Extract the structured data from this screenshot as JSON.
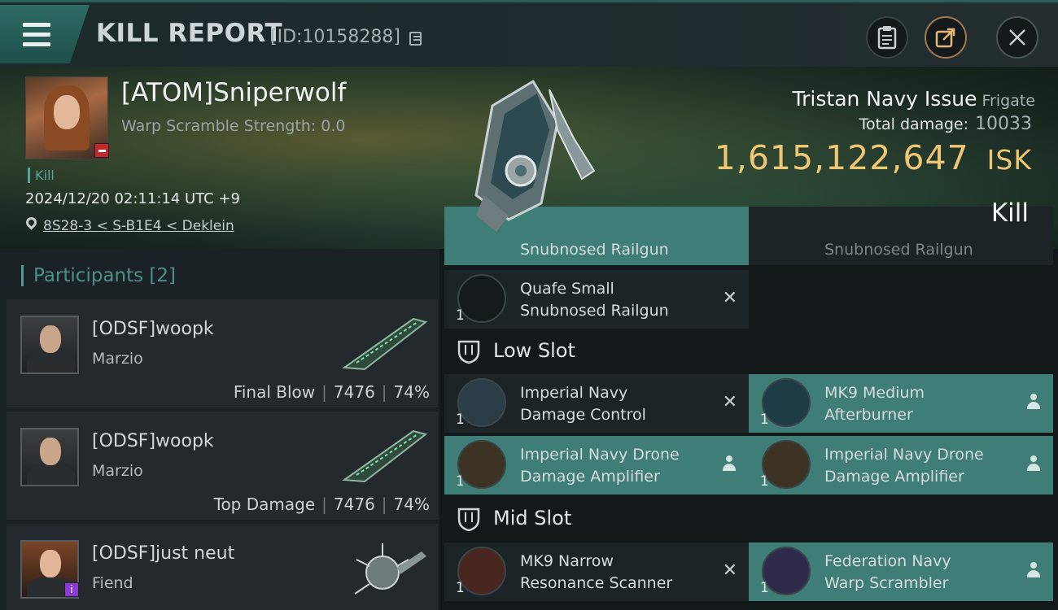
{
  "header": {
    "title": "KILL REPORT",
    "report_id": "[ID:10158288]"
  },
  "victim": {
    "name": "[ATOM]Sniperwolf",
    "warp_scramble": "Warp Scramble Strength: 0.0",
    "tag": "Kill",
    "datetime": "2024/12/20 02:11:14 UTC +9",
    "location": "8S28-3 < S-B1E4 < Deklein",
    "ship_name": "Tristan Navy Issue",
    "ship_class": "Frigate",
    "total_damage_label": "Total damage:",
    "total_damage": "10033",
    "isk_value": "1,615,122,647",
    "isk_unit": "ISK",
    "result_label": "Kill"
  },
  "participants": {
    "label": "Participants [2]",
    "rows": [
      {
        "name": "[ODSF]woopk",
        "ship": "Marzio",
        "stats_label": "Final Blow",
        "damage": "7476",
        "percent": "74%"
      },
      {
        "name": "[ODSF]woopk",
        "ship": "Marzio",
        "stats_label": "Top Damage",
        "damage": "7476",
        "percent": "74%"
      },
      {
        "name": "[ODSF]just neut",
        "ship": "Fiend",
        "stats_label": "",
        "damage": "",
        "percent": ""
      }
    ]
  },
  "modules": {
    "high_partial_left": "Snubnosed Railgun",
    "high_partial_right": "Snubnosed Railgun",
    "high_quafe": {
      "name1": "Quafe Small",
      "name2": "Snubnosed Railgun",
      "qty": "1"
    },
    "low_slot_label": "Low Slot",
    "mid_slot_label": "Mid Slot",
    "low": [
      {
        "name1": "Imperial Navy",
        "name2": "Damage Control",
        "qty": "1"
      },
      {
        "name1": "MK9 Medium",
        "name2": "Afterburner",
        "qty": "1"
      },
      {
        "name1": "Imperial Navy Drone",
        "name2": "Damage Amplifier",
        "qty": "1"
      },
      {
        "name1": "Imperial Navy Drone",
        "name2": "Damage Amplifier",
        "qty": "1"
      }
    ],
    "mid": [
      {
        "name1": "MK9 Narrow",
        "name2": "Resonance Scanner",
        "qty": "1"
      },
      {
        "name1": "Federation Navy",
        "name2": "Warp Scrambler",
        "qty": "1"
      }
    ]
  },
  "icons": {
    "menu": "hamburger-icon",
    "copy": "copy-icon",
    "clipboard": "clipboard-icon",
    "share": "share-icon",
    "close": "close-icon",
    "location": "pin-icon",
    "slot": "shield-icon",
    "fitted": "person-icon",
    "destroyed": "x-icon"
  },
  "colors": {
    "accent": "#4f9d96",
    "isk": "#efc774",
    "fitted_bg": "#3f7d77",
    "badge_red": "#c3262b",
    "badge_purple": "#8b3ad6"
  }
}
